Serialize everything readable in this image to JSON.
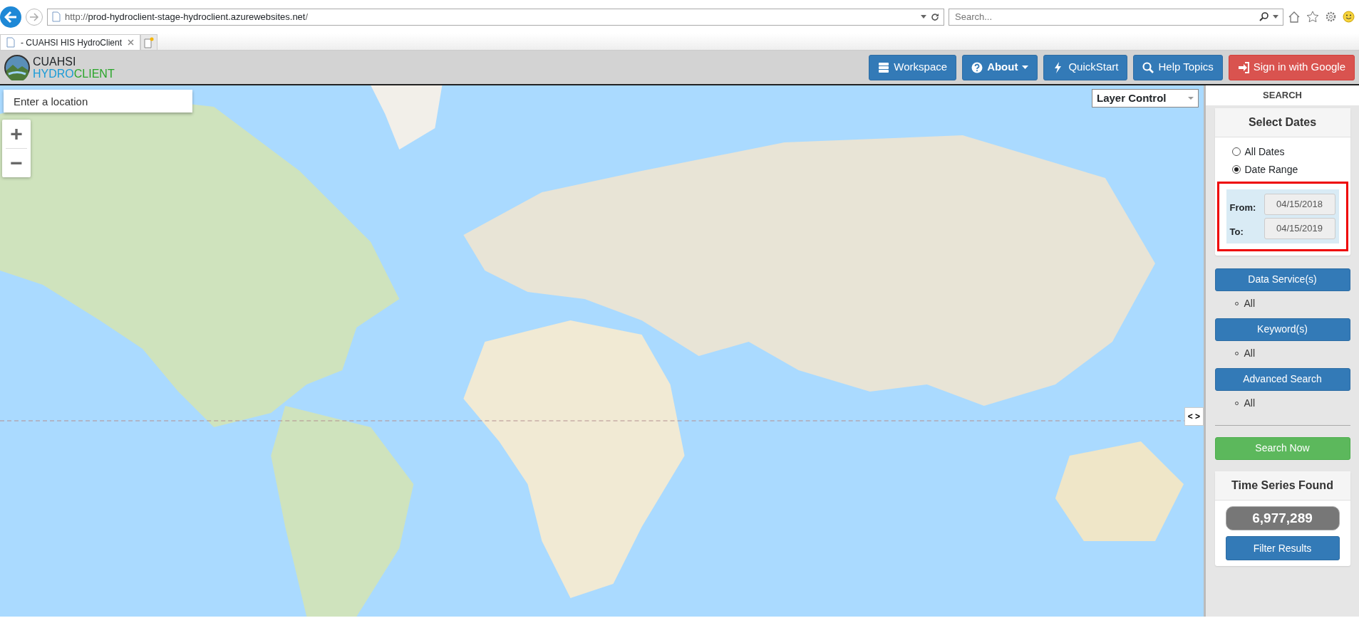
{
  "browser": {
    "url_prefix": "http://",
    "url_host": "prod-hydroclient-stage-hydroclient.azurewebsites.net",
    "url_suffix": "/",
    "search_placeholder": "Search...",
    "tabs": [
      {
        "title": "- CUAHSI HIS HydroClient",
        "selected": true
      }
    ]
  },
  "app_header": {
    "logo_top": "CUAHSI",
    "logo_bottom_a": "HYDRO",
    "logo_bottom_b": "CLIENT",
    "buttons": [
      {
        "label": "Workspace",
        "kind": "primary"
      },
      {
        "label": "About",
        "kind": "dropdown"
      },
      {
        "label": "QuickStart",
        "kind": "primary"
      },
      {
        "label": "Help Topics",
        "kind": "primary"
      },
      {
        "label": "Sign in with Google",
        "kind": "danger"
      }
    ]
  },
  "map": {
    "location_placeholder": "Enter a location",
    "zoom_in": "+",
    "zoom_out": "−",
    "layer_control": "Layer Control",
    "panel_toggle": "< >"
  },
  "sidebar": {
    "header": "SEARCH",
    "dates": {
      "title": "Select Dates",
      "options": [
        {
          "label": "All Dates",
          "selected": false
        },
        {
          "label": "Date Range",
          "selected": true
        }
      ],
      "from_label": "From:",
      "from_value": "04/15/2018",
      "to_label": "To:",
      "to_value": "04/15/2019"
    },
    "sections": [
      {
        "button": "Data Service(s)",
        "items": [
          "All"
        ]
      },
      {
        "button": "Keyword(s)",
        "items": [
          "All"
        ]
      },
      {
        "button": "Advanced Search",
        "items": [
          "All"
        ]
      }
    ],
    "search_button": "Search Now",
    "results": {
      "title": "Time Series Found",
      "count": "6,977,289",
      "filter_button": "Filter Results"
    }
  }
}
